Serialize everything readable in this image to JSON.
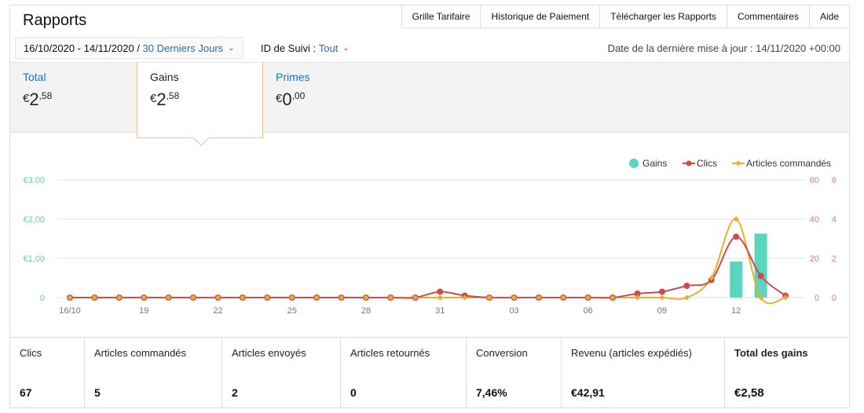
{
  "page": {
    "title": "Rapports"
  },
  "nav": {
    "items": [
      "Grille Tarifaire",
      "Historique de Paiement",
      "Télécharger les Rapports",
      "Commentaires",
      "Aide"
    ]
  },
  "filters": {
    "date_range": "16/10/2020 - 14/11/2020 /",
    "period": "30 Derniers Jours",
    "tracking_label": "ID de Suivi :",
    "tracking_value": "Tout",
    "last_update": "Date de la dernière mise à jour : 14/11/2020 +00:00"
  },
  "summary": [
    {
      "label": "Total",
      "currency": "€",
      "whole": "2",
      "decimals": ",58"
    },
    {
      "label": "Gains",
      "currency": "€",
      "whole": "2",
      "decimals": ",58"
    },
    {
      "label": "Primes",
      "currency": "€",
      "whole": "0",
      "decimals": ",00"
    }
  ],
  "chart_data": {
    "type": "bar+line",
    "x": [
      "16/10",
      "17/10",
      "18/10",
      "19/10",
      "20/10",
      "21/10",
      "22/10",
      "23/10",
      "24/10",
      "25/10",
      "26/10",
      "27/10",
      "28/10",
      "29/10",
      "30/10",
      "31/10",
      "01/11",
      "02/11",
      "03/11",
      "04/11",
      "05/11",
      "06/11",
      "07/11",
      "08/11",
      "09/11",
      "10/11",
      "11/11",
      "12/11",
      "13/11",
      "14/11"
    ],
    "x_tick_labels": [
      "16/10",
      "19",
      "22",
      "25",
      "28",
      "31",
      "03",
      "06",
      "09",
      "12"
    ],
    "y_left_ticks": [
      "0",
      "€1,00",
      "€2,00",
      "€3,00"
    ],
    "y_left_range": [
      0,
      3
    ],
    "y_right_clics_ticks": [
      "0",
      "20",
      "40",
      "60"
    ],
    "y_right_clics_range": [
      0,
      60
    ],
    "y_right_articles_ticks": [
      "0",
      "2",
      "4",
      "6"
    ],
    "y_right_articles_range": [
      0,
      6
    ],
    "legend_position": "top-right",
    "grid": true,
    "series": [
      {
        "name": "Gains",
        "kind": "bar",
        "color": "#5ad6bf",
        "values": [
          0,
          0,
          0,
          0,
          0,
          0,
          0,
          0,
          0,
          0,
          0,
          0,
          0,
          0,
          0,
          0,
          0,
          0,
          0,
          0,
          0,
          0,
          0,
          0,
          0,
          0,
          0,
          0.92,
          1.63,
          0
        ]
      },
      {
        "name": "Clics",
        "kind": "line",
        "color": "#cc4b4b",
        "values": [
          0,
          0,
          0,
          0,
          0,
          0,
          0,
          0,
          0,
          0,
          0,
          0,
          0,
          0,
          0,
          3,
          1,
          0,
          0,
          0,
          0,
          0,
          0,
          2,
          3,
          6,
          9,
          31,
          11,
          1
        ]
      },
      {
        "name": "Articles commandés",
        "kind": "line",
        "color": "#e8ae2c",
        "values": [
          0,
          0,
          0,
          0,
          0,
          0,
          0,
          0,
          0,
          0,
          0,
          0,
          0,
          0,
          0,
          0,
          0,
          0,
          0,
          0,
          0,
          0,
          0,
          0,
          0,
          0,
          1,
          4,
          0,
          0
        ]
      }
    ]
  },
  "stats": [
    {
      "label": "Clics",
      "value": "67"
    },
    {
      "label": "Articles commandés",
      "value": "5"
    },
    {
      "label": "Articles envoyés",
      "value": "2"
    },
    {
      "label": "Articles retournés",
      "value": "0"
    },
    {
      "label": "Conversion",
      "value": "7,46%"
    },
    {
      "label": "Revenu (articles expédiés)",
      "value": "€42,91"
    },
    {
      "label": "Total des gains",
      "value": "€2,58"
    }
  ]
}
